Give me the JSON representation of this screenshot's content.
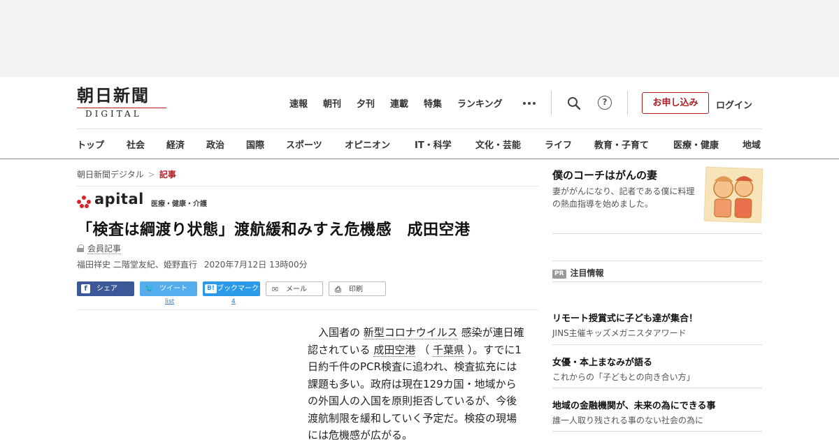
{
  "logo": {
    "main": "朝日新聞",
    "sub": "DIGITAL"
  },
  "topnav": [
    "速報",
    "朝刊",
    "夕刊",
    "連載",
    "特集",
    "ランキング"
  ],
  "header": {
    "apply": "お申し込み",
    "login": "ログイン",
    "help": "?"
  },
  "catnav": [
    "トップ",
    "社会",
    "経済",
    "政治",
    "国際",
    "スポーツ",
    "オピニオン",
    "IT・科学",
    "文化・芸能",
    "ライフ",
    "教育・子育て",
    "医療・健康",
    "地域"
  ],
  "breadcrumb": {
    "home": "朝日新聞デジタル",
    "sep": ">",
    "current": "記事"
  },
  "apital": {
    "word": "apital",
    "category": "医療・健康・介護"
  },
  "article": {
    "headline": "「検査は綱渡り状態」渡航緩和みすえ危機感　成田空港",
    "member_label": "会員記事",
    "authors": "福田祥史 二階堂友紀、姫野直行",
    "date": "2020年7月12日 13時00分",
    "body": {
      "p1": "入国者の",
      "link1": "新型コロナウイルス",
      "p2": "感染が連日確認されている",
      "link2": "成田空港",
      "p3": "（",
      "link3": "千葉県",
      "p4": "）。すでに1日約千件のPCR検査に追われ、検査拡充には課題も多い。政府は現在129カ国・地域からの外国人の入国を原則拒否しているが、今後渡航制限を緩和していく予定だ。検疫の現場には危機感が広がる。"
    }
  },
  "share": {
    "facebook": "シェア",
    "twitter": "ツイート",
    "hatena": "ブックマーク",
    "hatena_icon": "B!",
    "mail": "メール",
    "print": "印刷",
    "twitter_count": "list",
    "hatena_count": "4"
  },
  "sidebar": {
    "feature_title": "僕のコーチはがんの妻",
    "feature_desc": "妻ががんになり、記者である僕に料理の熱血指導を始めました。",
    "pr_badge": "PR",
    "pr_heading": "注目情報",
    "pr_items": [
      {
        "title": "リモート授賞式に子ども達が集合！",
        "sub": "JINS主催キッズメガニスタアワード"
      },
      {
        "title": "女優・本上まなみが語る",
        "sub": "これからの「子どもとの向き合い方」"
      },
      {
        "title": "地域の金融機関が、未来の為にできる事",
        "sub": "誰一人取り残される事のない社会の為に"
      }
    ]
  },
  "colors": {
    "brand_red": "#b01e23",
    "facebook": "#3b5998",
    "twitter": "#55acee",
    "hatena": "#2b9ae8",
    "apital_dot": "#d8232a"
  },
  "icons": [
    "search-icon",
    "help-icon",
    "lock-icon",
    "facebook-icon",
    "twitter-icon",
    "hatena-icon",
    "mail-icon",
    "print-icon",
    "more-dots-icon"
  ]
}
